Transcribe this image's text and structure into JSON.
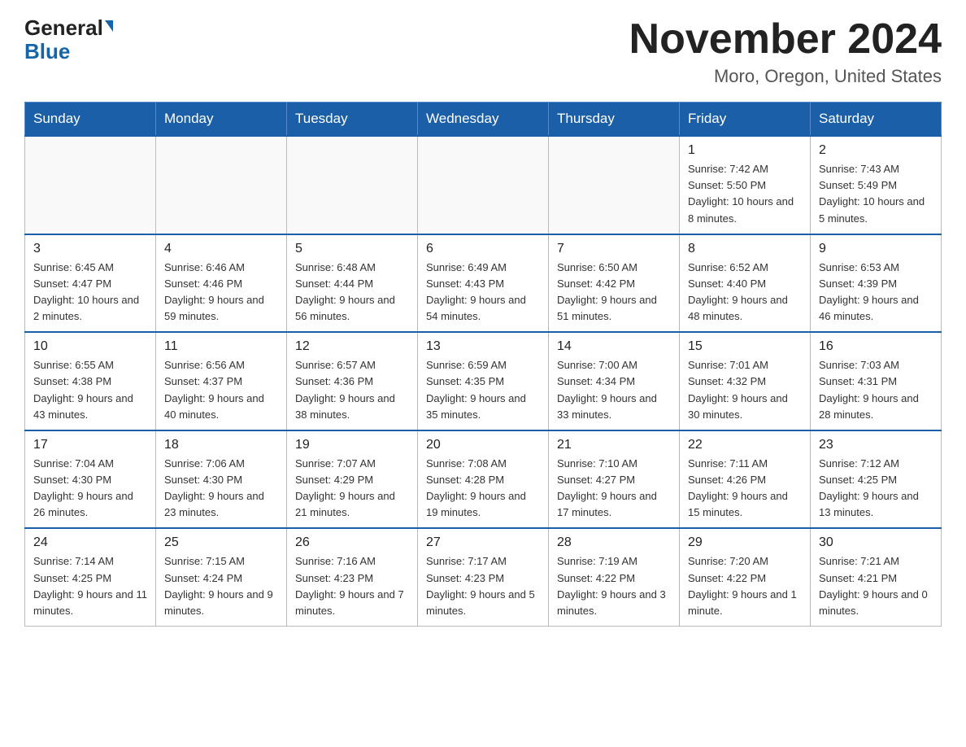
{
  "header": {
    "logo_general": "General",
    "logo_blue": "Blue",
    "title": "November 2024",
    "location": "Moro, Oregon, United States"
  },
  "weekdays": [
    "Sunday",
    "Monday",
    "Tuesday",
    "Wednesday",
    "Thursday",
    "Friday",
    "Saturday"
  ],
  "weeks": [
    [
      {
        "day": "",
        "info": ""
      },
      {
        "day": "",
        "info": ""
      },
      {
        "day": "",
        "info": ""
      },
      {
        "day": "",
        "info": ""
      },
      {
        "day": "",
        "info": ""
      },
      {
        "day": "1",
        "info": "Sunrise: 7:42 AM\nSunset: 5:50 PM\nDaylight: 10 hours and 8 minutes."
      },
      {
        "day": "2",
        "info": "Sunrise: 7:43 AM\nSunset: 5:49 PM\nDaylight: 10 hours and 5 minutes."
      }
    ],
    [
      {
        "day": "3",
        "info": "Sunrise: 6:45 AM\nSunset: 4:47 PM\nDaylight: 10 hours and 2 minutes."
      },
      {
        "day": "4",
        "info": "Sunrise: 6:46 AM\nSunset: 4:46 PM\nDaylight: 9 hours and 59 minutes."
      },
      {
        "day": "5",
        "info": "Sunrise: 6:48 AM\nSunset: 4:44 PM\nDaylight: 9 hours and 56 minutes."
      },
      {
        "day": "6",
        "info": "Sunrise: 6:49 AM\nSunset: 4:43 PM\nDaylight: 9 hours and 54 minutes."
      },
      {
        "day": "7",
        "info": "Sunrise: 6:50 AM\nSunset: 4:42 PM\nDaylight: 9 hours and 51 minutes."
      },
      {
        "day": "8",
        "info": "Sunrise: 6:52 AM\nSunset: 4:40 PM\nDaylight: 9 hours and 48 minutes."
      },
      {
        "day": "9",
        "info": "Sunrise: 6:53 AM\nSunset: 4:39 PM\nDaylight: 9 hours and 46 minutes."
      }
    ],
    [
      {
        "day": "10",
        "info": "Sunrise: 6:55 AM\nSunset: 4:38 PM\nDaylight: 9 hours and 43 minutes."
      },
      {
        "day": "11",
        "info": "Sunrise: 6:56 AM\nSunset: 4:37 PM\nDaylight: 9 hours and 40 minutes."
      },
      {
        "day": "12",
        "info": "Sunrise: 6:57 AM\nSunset: 4:36 PM\nDaylight: 9 hours and 38 minutes."
      },
      {
        "day": "13",
        "info": "Sunrise: 6:59 AM\nSunset: 4:35 PM\nDaylight: 9 hours and 35 minutes."
      },
      {
        "day": "14",
        "info": "Sunrise: 7:00 AM\nSunset: 4:34 PM\nDaylight: 9 hours and 33 minutes."
      },
      {
        "day": "15",
        "info": "Sunrise: 7:01 AM\nSunset: 4:32 PM\nDaylight: 9 hours and 30 minutes."
      },
      {
        "day": "16",
        "info": "Sunrise: 7:03 AM\nSunset: 4:31 PM\nDaylight: 9 hours and 28 minutes."
      }
    ],
    [
      {
        "day": "17",
        "info": "Sunrise: 7:04 AM\nSunset: 4:30 PM\nDaylight: 9 hours and 26 minutes."
      },
      {
        "day": "18",
        "info": "Sunrise: 7:06 AM\nSunset: 4:30 PM\nDaylight: 9 hours and 23 minutes."
      },
      {
        "day": "19",
        "info": "Sunrise: 7:07 AM\nSunset: 4:29 PM\nDaylight: 9 hours and 21 minutes."
      },
      {
        "day": "20",
        "info": "Sunrise: 7:08 AM\nSunset: 4:28 PM\nDaylight: 9 hours and 19 minutes."
      },
      {
        "day": "21",
        "info": "Sunrise: 7:10 AM\nSunset: 4:27 PM\nDaylight: 9 hours and 17 minutes."
      },
      {
        "day": "22",
        "info": "Sunrise: 7:11 AM\nSunset: 4:26 PM\nDaylight: 9 hours and 15 minutes."
      },
      {
        "day": "23",
        "info": "Sunrise: 7:12 AM\nSunset: 4:25 PM\nDaylight: 9 hours and 13 minutes."
      }
    ],
    [
      {
        "day": "24",
        "info": "Sunrise: 7:14 AM\nSunset: 4:25 PM\nDaylight: 9 hours and 11 minutes."
      },
      {
        "day": "25",
        "info": "Sunrise: 7:15 AM\nSunset: 4:24 PM\nDaylight: 9 hours and 9 minutes."
      },
      {
        "day": "26",
        "info": "Sunrise: 7:16 AM\nSunset: 4:23 PM\nDaylight: 9 hours and 7 minutes."
      },
      {
        "day": "27",
        "info": "Sunrise: 7:17 AM\nSunset: 4:23 PM\nDaylight: 9 hours and 5 minutes."
      },
      {
        "day": "28",
        "info": "Sunrise: 7:19 AM\nSunset: 4:22 PM\nDaylight: 9 hours and 3 minutes."
      },
      {
        "day": "29",
        "info": "Sunrise: 7:20 AM\nSunset: 4:22 PM\nDaylight: 9 hours and 1 minute."
      },
      {
        "day": "30",
        "info": "Sunrise: 7:21 AM\nSunset: 4:21 PM\nDaylight: 9 hours and 0 minutes."
      }
    ]
  ]
}
